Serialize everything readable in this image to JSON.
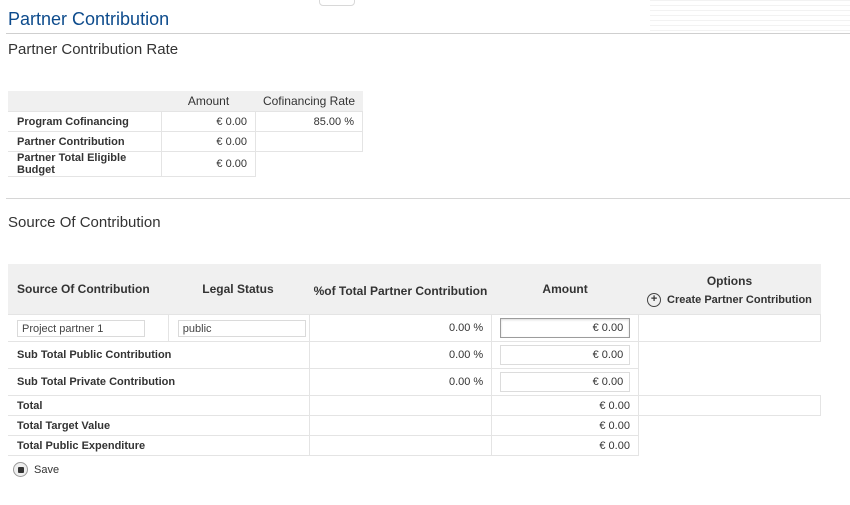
{
  "page": {
    "title": "Partner Contribution"
  },
  "rate_section": {
    "title": "Partner Contribution Rate",
    "headers": [
      "Amount",
      "Cofinancing Rate"
    ],
    "rows": [
      {
        "label": "Program Cofinancing",
        "amount": "€ 0.00",
        "rate": "85.00 %"
      },
      {
        "label": "Partner Contribution",
        "amount": "€ 0.00",
        "rate": ""
      },
      {
        "label": "Partner Total Eligible Budget",
        "amount": "€ 0.00"
      }
    ]
  },
  "source_section": {
    "title": "Source Of Contribution",
    "headers": {
      "source": "Source Of Contribution",
      "legal_status": "Legal Status",
      "percent": "%of Total Partner Contribution",
      "amount": "Amount",
      "options": "Options"
    },
    "create_label": "Create Partner Contribution",
    "partner_row": {
      "source": "Project partner 1",
      "legal_status": "public",
      "percent": "0.00 %",
      "amount": "€ 0.00"
    },
    "sub_public": {
      "label": "Sub Total Public Contribution",
      "percent": "0.00 %",
      "amount": "€ 0.00"
    },
    "sub_private": {
      "label": "Sub Total Private Contribution",
      "percent": "0.00 %",
      "amount": "€ 0.00"
    },
    "total": {
      "label": "Total",
      "amount": "€ 0.00"
    },
    "target": {
      "label": "Total Target Value",
      "amount": "€ 0.00"
    },
    "expenditure": {
      "label": "Total Public Expenditure",
      "amount": "€ 0.00"
    }
  },
  "save_label": "Save"
}
